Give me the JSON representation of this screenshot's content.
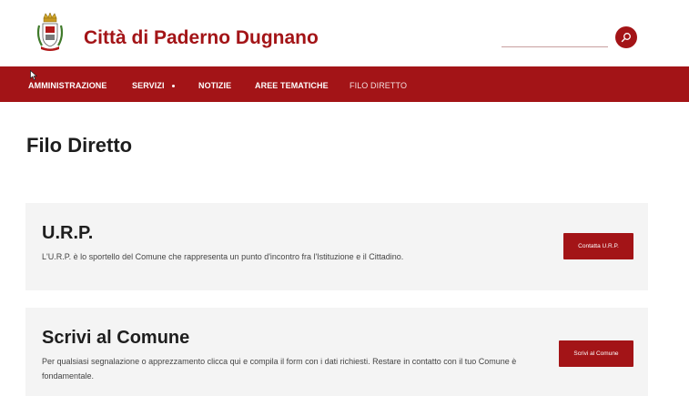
{
  "header": {
    "site_title": "Città di Paderno Dugnano"
  },
  "nav": {
    "items": [
      {
        "label": "AMMINISTRAZIONE"
      },
      {
        "label": "SERVIZI"
      },
      {
        "label": "NOTIZIE"
      },
      {
        "label": "AREE TEMATICHE"
      },
      {
        "label": "FILO DIRETTO"
      }
    ]
  },
  "main": {
    "page_title": "Filo Diretto",
    "cards": [
      {
        "title": "U.R.P.",
        "text": "L'U.R.P. è lo sportello del Comune che rappresenta un punto d'incontro fra l'Istituzione e il Cittadino.",
        "button": "Contatta U.R.P."
      },
      {
        "title": "Scrivi al Comune",
        "text": "Per qualsiasi segnalazione o apprezzamento clicca qui e compila il form con i dati richiesti. Restare in contatto con il tuo Comune è fondamentale.",
        "button": "Scrivi al Comune"
      }
    ]
  },
  "icons": {
    "crest": "coat-of-arms-icon",
    "search": "search-icon",
    "nav_dropdown": "dot-icon",
    "cursor": "mouse-cursor-icon"
  },
  "colors": {
    "brand": "#a31417",
    "card_bg": "#f4f4f4"
  }
}
